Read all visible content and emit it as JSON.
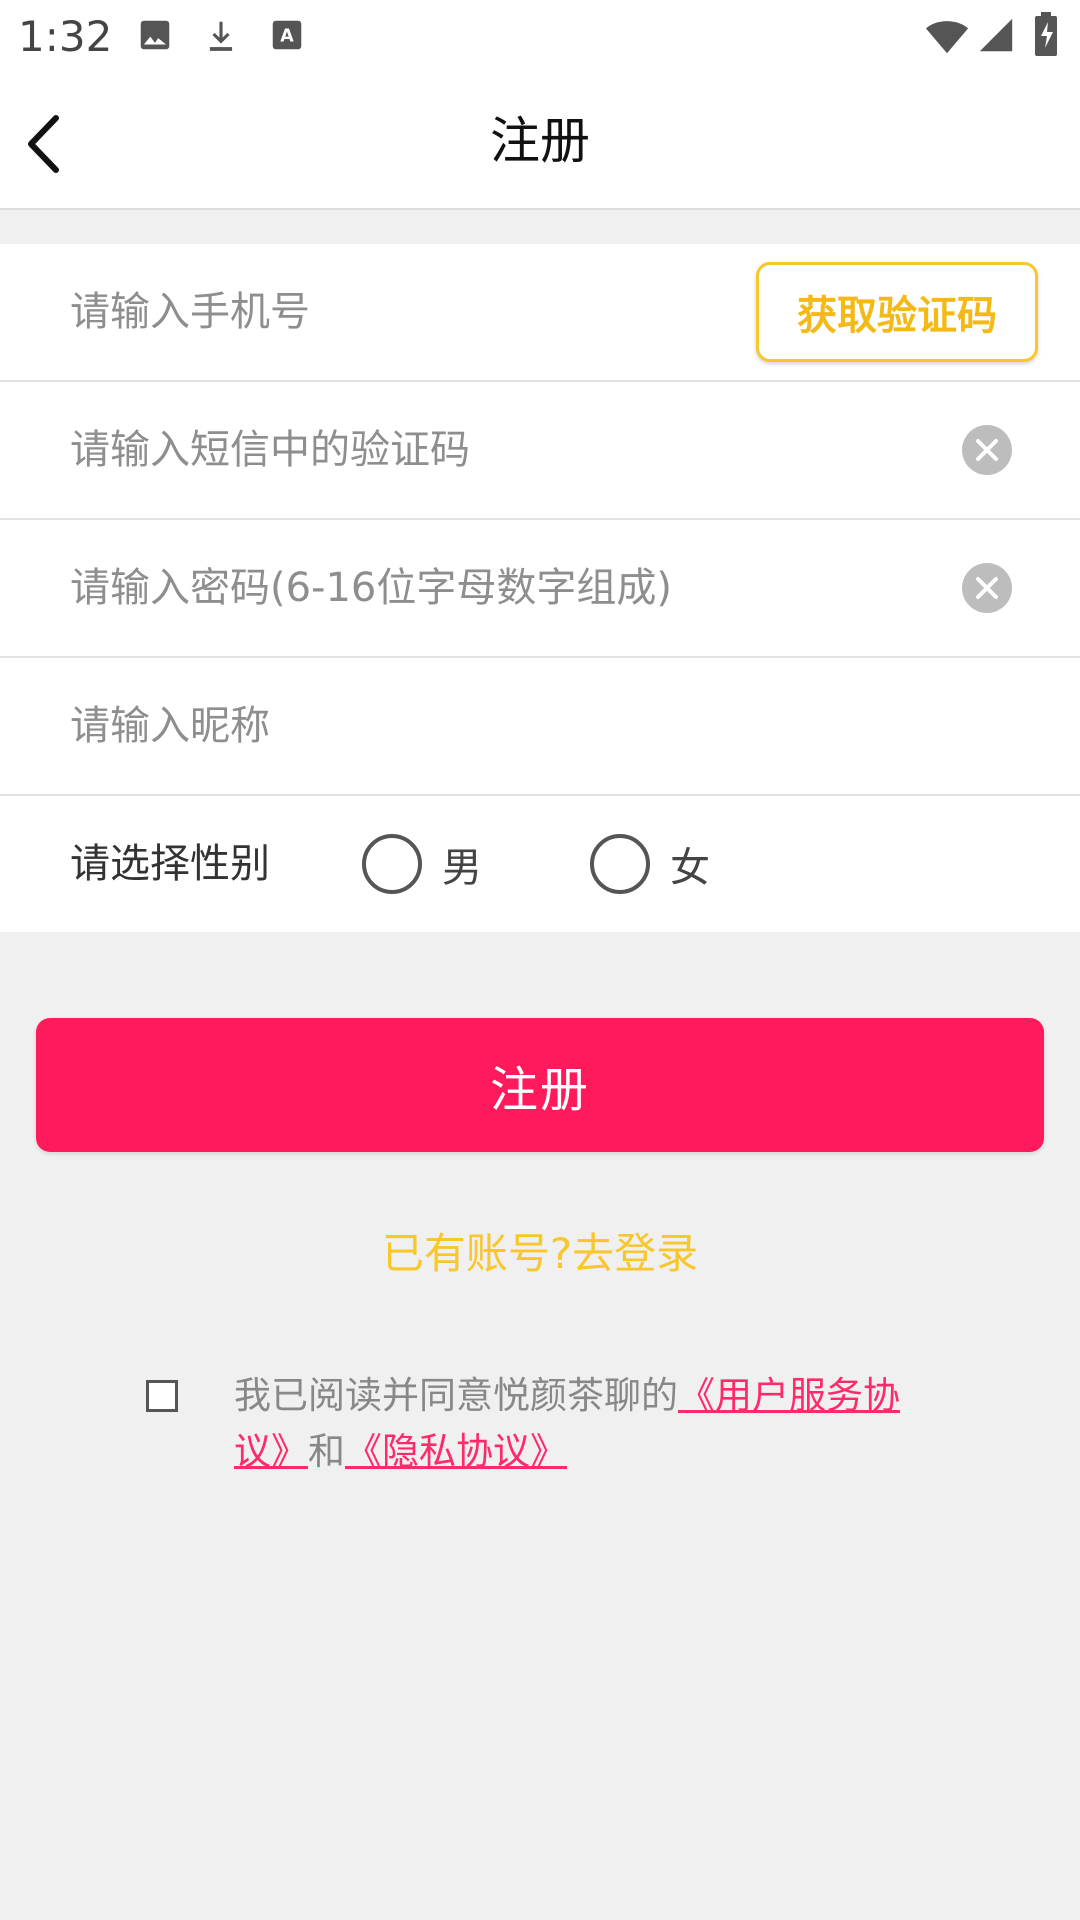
{
  "status_bar": {
    "time": "1:32",
    "left_icons": [
      "image-icon",
      "download-icon",
      "text-icon"
    ],
    "right_icons": [
      "wifi-icon",
      "signal-icon",
      "battery-icon"
    ]
  },
  "header": {
    "title": "注册",
    "back_icon": "chevron-left-icon"
  },
  "form": {
    "phone_placeholder": "请输入手机号",
    "get_code_label": "获取验证码",
    "sms_code_placeholder": "请输入短信中的验证码",
    "password_placeholder": "请输入密码(6-16位字母数字组成)",
    "nickname_placeholder": "请输入昵称",
    "gender_label": "请选择性别",
    "gender_options": [
      "男",
      "女"
    ]
  },
  "register_button_label": "注册",
  "login_link_label": "已有账号?去登录",
  "agreement": {
    "prefix": "我已阅读并同意悦颜茶聊的",
    "user_agreement": "《用户服务协议》",
    "conjunction": "和",
    "privacy_agreement": "《隐私协议》"
  },
  "colors": {
    "accent_yellow": "#f9c62c",
    "primary_pink": "#ff1a5b",
    "link_pink": "#ff2a6a",
    "background": "#f0f0f0"
  }
}
